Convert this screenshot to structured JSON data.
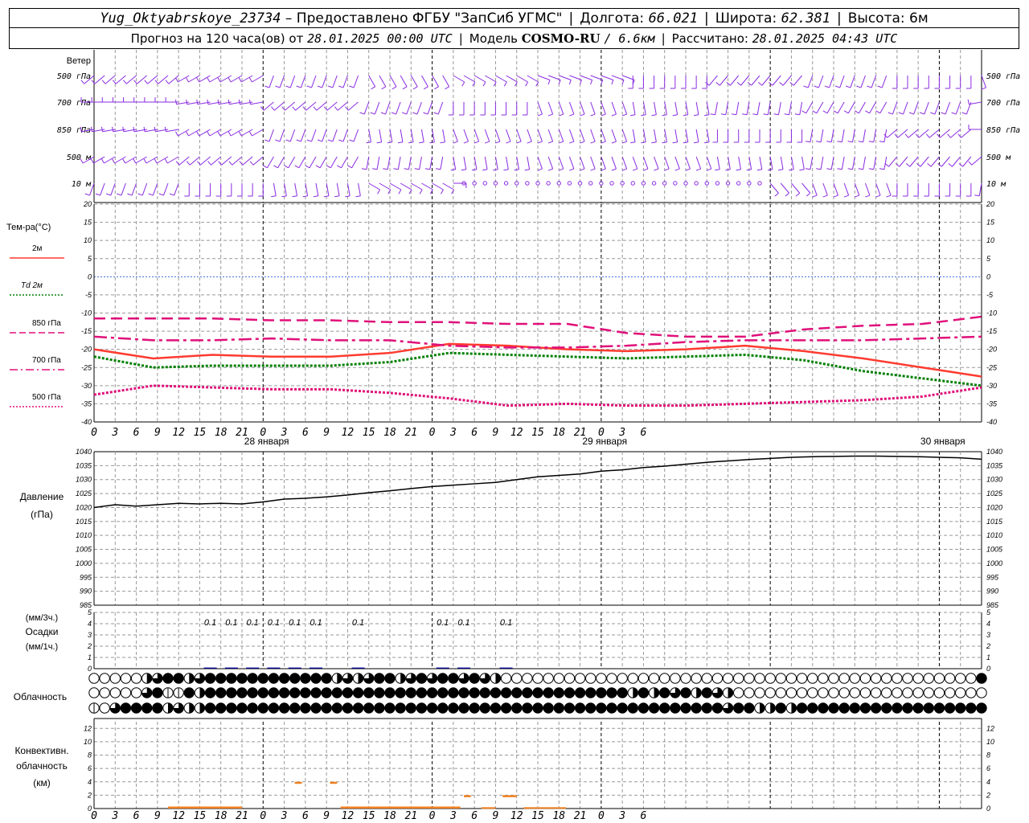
{
  "header": {
    "station": "Yug_Oktyabrskoye_23734",
    "provider": "– Предоставлено ФГБУ \"ЗапСиб УГМС\"",
    "lon_label": "Долгота:",
    "lon": "66.021",
    "lat_label": "Широта:",
    "lat": "62.381",
    "alt_label": "Высота:",
    "alt": "6м",
    "forecast_prefix": "Прогноз на 120 часа(ов) от",
    "forecast_start": "28.01.2025 00:00 UTC",
    "model_label": "Модель",
    "model": "COSMO-RU",
    "model_res": "/ 6.6км",
    "calc_label": "Рассчитано:",
    "calc_time": "28.01.2025 04:43 UTC"
  },
  "wind_panel": {
    "title": "Ветер",
    "levels": [
      "500 гПа",
      "700 гПа",
      "850 гПа",
      "500 м",
      "10 м"
    ]
  },
  "temp_panel": {
    "title": "Тем-ра(°C)",
    "yticks": [
      20,
      15,
      10,
      5,
      0,
      -5,
      -10,
      -15,
      -20,
      -25,
      -30,
      -35,
      -40
    ],
    "legend": [
      {
        "label": "2м",
        "color": "#ff3b30",
        "style": "solid"
      },
      {
        "label": "Td 2м",
        "color": "#008000",
        "style": "dotted"
      },
      {
        "label": "850 гПа",
        "color": "#e0107a",
        "style": "dashed"
      },
      {
        "label": "700 гПа",
        "color": "#e0107a",
        "style": "dashdot"
      },
      {
        "label": "500 гПа",
        "color": "#e0107a",
        "style": "dotted"
      }
    ]
  },
  "hour_ticks": [
    "0",
    "3",
    "6",
    "9",
    "12",
    "15",
    "18",
    "21",
    "0",
    "3",
    "6",
    "9",
    "12",
    "15",
    "18",
    "21",
    "0",
    "3",
    "6",
    "9",
    "12",
    "15",
    "18",
    "21",
    "0",
    "3",
    "6"
  ],
  "day_labels": [
    "28 января",
    "29 января",
    "30 января"
  ],
  "pressure_panel": {
    "title": "Давление",
    "unit": "(гПа)",
    "yticks": [
      1040,
      1035,
      1030,
      1025,
      1020,
      1015,
      1010,
      1005,
      1000,
      995,
      990,
      985
    ]
  },
  "precip_panel": {
    "unit3": "(мм/3ч.)",
    "title": "Осадки",
    "unit1": "(мм/1ч.)",
    "yticks": [
      5,
      4,
      3,
      2,
      1,
      0
    ],
    "labels": [
      {
        "hour": 16.5,
        "text": "0.1"
      },
      {
        "hour": 19.5,
        "text": "0.1"
      },
      {
        "hour": 22.5,
        "text": "0.1"
      },
      {
        "hour": 25.5,
        "text": "0.1"
      },
      {
        "hour": 28.5,
        "text": "0.1"
      },
      {
        "hour": 31.5,
        "text": "0.1"
      },
      {
        "hour": 37.5,
        "text": "0.1"
      },
      {
        "hour": 49.5,
        "text": "0.1"
      },
      {
        "hour": 52.5,
        "text": "0.1"
      },
      {
        "hour": 58.5,
        "text": "0.1"
      }
    ]
  },
  "cloud_panel": {
    "title": "Облачность",
    "rows": [
      "0000023442344444444444423234423434434320000000000000000000000000000000000000000000004",
      "0000034114244444444444444444444444444444444444444442424342432000000000000000000000000",
      "1034444232244444444444444444444444444444444444444444444444443442242444444444444444444"
    ]
  },
  "conv_panel": {
    "title1": "Конвективн.",
    "title2": "облачность",
    "unit": "(км)",
    "yticks": [
      12,
      10,
      8,
      6,
      4,
      2,
      0
    ]
  },
  "chart_data": [
    {
      "type": "wind_barbs",
      "title": "Ветер",
      "levels": [
        "500 гПа",
        "700 гПа",
        "850 гПа",
        "500 м",
        "10 м"
      ],
      "time_range_h": [
        0,
        126
      ]
    },
    {
      "type": "line",
      "title": "Тем-ра(°C)",
      "ylim": [
        -40,
        20
      ],
      "x_hours": [
        0,
        6,
        12,
        18,
        24,
        30,
        36,
        42,
        48,
        54,
        60,
        66,
        72,
        78,
        84,
        90,
        96,
        102,
        108,
        114,
        120,
        126
      ],
      "series": [
        {
          "name": "2м",
          "color": "#ff3b30",
          "values": [
            -20,
            -22.5,
            -21.5,
            -22,
            -22,
            -21,
            -18.5,
            -19,
            -20,
            -20.5,
            -20,
            -19,
            -20.5,
            -22.5,
            -25,
            -27.5
          ]
        },
        {
          "name": "Td 2м",
          "color": "#008000",
          "values": [
            -22,
            -25,
            -24.5,
            -24.5,
            -24.5,
            -23.5,
            -21,
            -21.5,
            -22,
            -22.5,
            -22,
            -21.5,
            -23,
            -26,
            -28,
            -30
          ]
        },
        {
          "name": "850 гПа",
          "color": "#e0107a",
          "values": [
            -11.5,
            -11.5,
            -11.5,
            -12,
            -12,
            -12.5,
            -12.5,
            -13,
            -13,
            -15.5,
            -16.5,
            -16.5,
            -14.5,
            -13.5,
            -13,
            -11
          ]
        },
        {
          "name": "700 гПа",
          "color": "#e0107a",
          "values": [
            -16.5,
            -17.5,
            -17.5,
            -17,
            -17.5,
            -17.5,
            -19,
            -19.5,
            -19.5,
            -19,
            -18,
            -17.5,
            -17.5,
            -17.5,
            -17,
            -16.5
          ]
        },
        {
          "name": "500 гПа",
          "color": "#e0107a",
          "values": [
            -32.5,
            -30,
            -30.5,
            -31,
            -31,
            -32,
            -33.5,
            -35.5,
            -35,
            -35.5,
            -35.5,
            -35,
            -34.5,
            -34,
            -33,
            -30.5
          ]
        }
      ]
    },
    {
      "type": "line",
      "title": "Давление",
      "ylim": [
        985,
        1040
      ],
      "x_hours": [
        0,
        3,
        6,
        9,
        12,
        15,
        18,
        21,
        24,
        27,
        30,
        33,
        36,
        39,
        42,
        45,
        48,
        51,
        54,
        57,
        60,
        63,
        66,
        69,
        72,
        75,
        78,
        81,
        84,
        87,
        90,
        93,
        96,
        99,
        102,
        105,
        108,
        111,
        114,
        117,
        120,
        123,
        126
      ],
      "series": [
        {
          "name": "Давление",
          "color": "#000000",
          "values": [
            1020,
            1021,
            1020.5,
            1021,
            1021.5,
            1021.3,
            1021.5,
            1021.3,
            1022,
            1023,
            1023.3,
            1023.8,
            1024.5,
            1025.3,
            1026,
            1026.8,
            1027.5,
            1028,
            1028.5,
            1029,
            1030,
            1031,
            1031.5,
            1032,
            1033,
            1033.5,
            1034.3,
            1034.8,
            1035.5,
            1036.2,
            1036.7,
            1037.2,
            1037.6,
            1038,
            1038.2,
            1038.3,
            1038.4,
            1038.4,
            1038.3,
            1038.2,
            1038,
            1037.8,
            1037.3
          ]
        }
      ]
    },
    {
      "type": "bar",
      "title": "Осадки",
      "ylim": [
        0,
        5
      ],
      "x_hours": [
        16.5,
        19.5,
        22.5,
        25.5,
        28.5,
        31.5,
        37.5,
        49.5,
        52.5,
        58.5
      ],
      "values": [
        0.1,
        0.1,
        0.1,
        0.1,
        0.1,
        0.1,
        0.1,
        0.1,
        0.1,
        0.1
      ]
    },
    {
      "type": "bar",
      "title": "Конвективн. облачность",
      "ylim": [
        0,
        13
      ],
      "segments": [
        {
          "from": 10.5,
          "to": 21,
          "base": 0,
          "top": 0.3
        },
        {
          "from": 28.5,
          "to": 29.5,
          "base": 3.7,
          "top": 4
        },
        {
          "from": 33.5,
          "to": 34.5,
          "base": 3.7,
          "top": 4
        },
        {
          "from": 35,
          "to": 52,
          "base": 0,
          "top": 0.3
        },
        {
          "from": 52.5,
          "to": 53.5,
          "base": 1.7,
          "top": 2
        },
        {
          "from": 58,
          "to": 60,
          "base": 1.7,
          "top": 2
        },
        {
          "from": 55,
          "to": 57,
          "base": 0,
          "top": 0.2
        },
        {
          "from": 61,
          "to": 67,
          "base": 0,
          "top": 0.2
        }
      ]
    }
  ],
  "colors": {
    "grid": "#999999",
    "wind": "#8a2be2",
    "temp2m": "#ff3b30",
    "td": "#008000",
    "upper": "#e0107a",
    "conv": "#f08020",
    "precip": "#00008b",
    "zero": "#4169e1"
  }
}
